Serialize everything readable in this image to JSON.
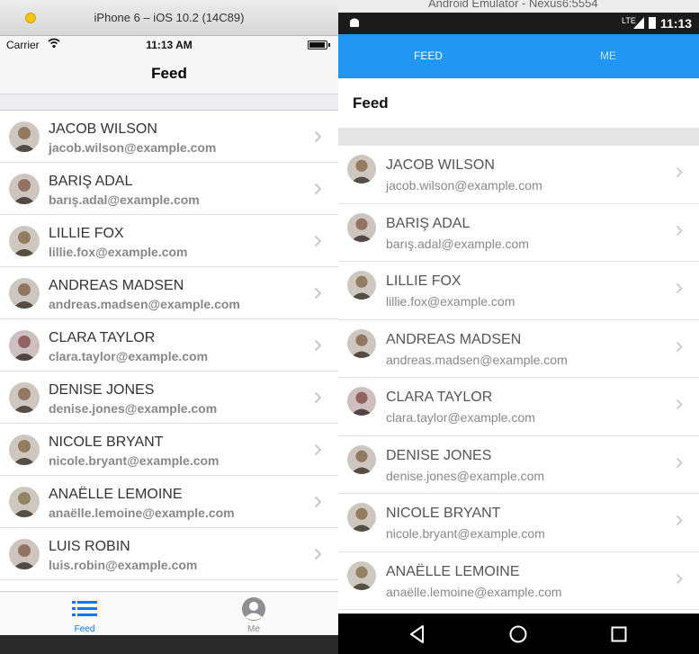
{
  "ios": {
    "window_title": "iPhone 6 – iOS 10.2 (14C89)",
    "status": {
      "carrier": "Carrier",
      "time": "11:13 AM"
    },
    "nav_title": "Feed",
    "tabs": [
      {
        "label": "Feed",
        "icon": "list-icon",
        "active": true
      },
      {
        "label": "Me",
        "icon": "person-icon",
        "active": false
      }
    ],
    "accent_color": "#007aff"
  },
  "android": {
    "window_title": "Android Emulator - Nexus6:5554",
    "status": {
      "network": "LTE",
      "time": "11:13"
    },
    "tabs": [
      {
        "label": "FEED",
        "active": true
      },
      {
        "label": "ME",
        "active": false
      }
    ],
    "page_title": "Feed",
    "colors": {
      "toolbar": "#2196f3",
      "indicator": "#f6e53a"
    }
  },
  "users": [
    {
      "name": "JACOB WILSON",
      "email": "jacob.wilson@example.com"
    },
    {
      "name": "BARIŞ ADAL",
      "email": "barış.adal@example.com"
    },
    {
      "name": "LILLIE FOX",
      "email": "lillie.fox@example.com"
    },
    {
      "name": "ANDREAS MADSEN",
      "email": "andreas.madsen@example.com"
    },
    {
      "name": "CLARA TAYLOR",
      "email": "clara.taylor@example.com"
    },
    {
      "name": "DENISE JONES",
      "email": "denise.jones@example.com"
    },
    {
      "name": "NICOLE BRYANT",
      "email": "nicole.bryant@example.com"
    },
    {
      "name": "ANAËLLE LEMOINE",
      "email": "anaëlle.lemoine@example.com"
    },
    {
      "name": "LUIS ROBIN",
      "email": "luis.robin@example.com"
    }
  ]
}
